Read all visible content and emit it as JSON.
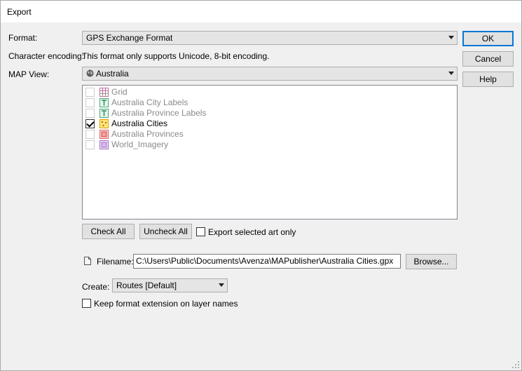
{
  "window": {
    "title": "Export"
  },
  "format": {
    "label": "Format:",
    "value": "GPS Exchange Format"
  },
  "encoding": {
    "label": "Character encoding:",
    "value": "This format only supports Unicode, 8-bit encoding."
  },
  "map_view": {
    "label": "MAP View:",
    "value": "Australia",
    "icon": "globe-icon"
  },
  "layers": [
    {
      "name": "Grid",
      "checked": false,
      "enabled": false,
      "icon": "grid-layer-icon",
      "color": "#c070a0"
    },
    {
      "name": "Australia City Labels",
      "checked": false,
      "enabled": false,
      "icon": "text-layer-icon",
      "color": "#48a878"
    },
    {
      "name": "Australia Province Labels",
      "checked": false,
      "enabled": false,
      "icon": "text-layer-icon",
      "color": "#48a878"
    },
    {
      "name": "Australia Cities",
      "checked": true,
      "enabled": true,
      "icon": "point-layer-icon",
      "color": "#e0a000"
    },
    {
      "name": "Australia Provinces",
      "checked": false,
      "enabled": false,
      "icon": "polygon-layer-icon",
      "color": "#e06060"
    },
    {
      "name": "World_Imagery",
      "checked": false,
      "enabled": false,
      "icon": "image-layer-icon",
      "color": "#a070c0"
    }
  ],
  "buttons": {
    "ok": "OK",
    "cancel": "Cancel",
    "help": "Help",
    "check_all": "Check All",
    "uncheck_all": "Uncheck All",
    "browse": "Browse..."
  },
  "export_selected": {
    "label": "Export selected art only",
    "checked": false
  },
  "filename": {
    "label": "Filename:",
    "value": "C:\\Users\\Public\\Documents\\Avenza\\MAPublisher\\Australia Cities.gpx"
  },
  "create": {
    "label": "Create:",
    "value": "Routes [Default]"
  },
  "keep_extension": {
    "label": "Keep format extension on layer names",
    "checked": false
  },
  "colors": {
    "accent": "#0078d7",
    "dialog_bg": "#f0f0f0"
  }
}
